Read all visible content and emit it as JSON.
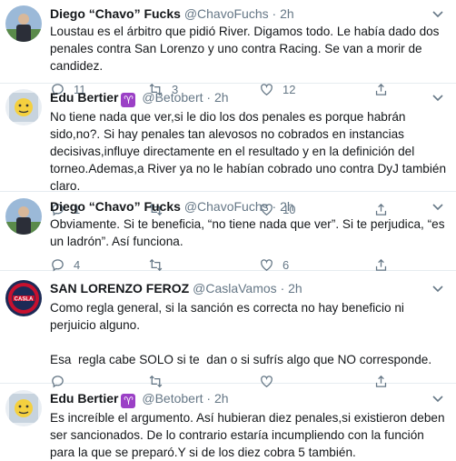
{
  "tweets": [
    {
      "name": "Diego “Chavo” Fucks",
      "handle": "@ChavoFuchs",
      "dot": "·",
      "time": "2h",
      "avatar": "avatar-diego",
      "text": "Loustau es el árbitro que pidió River. Digamos todo. Le había dado dos penales contra San Lorenzo y uno contra Racing. Se van a morir de candidez.",
      "replies": "11",
      "retweets": "3",
      "likes": "12"
    },
    {
      "name": "Edu Bertier",
      "badge": "♈",
      "handle": "@Betobert",
      "dot": "·",
      "time": "2h",
      "avatar": "avatar-edu",
      "text": "No tiene nada que ver,si le dio los dos penales es porque habrán sido,no?. Si hay penales tan alevosos no cobrados en instancias decisivas,influye directamente en el resultado y en la definición del torneo.Ademas,a River ya no le habían cobrado uno contra DyJ también claro.",
      "replies": "1",
      "retweets": "",
      "likes": "10"
    },
    {
      "name": "Diego “Chavo” Fucks",
      "handle": "@ChavoFuchs",
      "dot": "·",
      "time": "2h",
      "avatar": "avatar-diego",
      "text": "Obviamente. Si te beneficia, “no tiene nada que ver”. Si te perjudica, “es un ladrón”. Así funciona.",
      "replies": "4",
      "retweets": "",
      "likes": "6"
    },
    {
      "name": "SAN LORENZO FEROZ",
      "handle": "@CaslaVamos",
      "dot": "·",
      "time": "2h",
      "avatar": "avatar-sanlorenzo",
      "text": "Como regla general, si la sanción es correcta no hay beneficio ni perjuicio alguno.\n\nEsa  regla cabe SOLO si te  dan o si sufrís algo que NO corresponde.",
      "replies": "",
      "retweets": "",
      "likes": ""
    },
    {
      "name": "Edu Bertier",
      "badge": "♈",
      "handle": "@Betobert",
      "dot": "·",
      "time": "2h",
      "avatar": "avatar-edu",
      "text": "Es increíble el argumento. Así hubieran diez penales,si existieron deben ser sancionados. De lo contrario estaría incumpliendo con la función para la que se preparó.Y si de los diez cobra 5 también."
    }
  ]
}
